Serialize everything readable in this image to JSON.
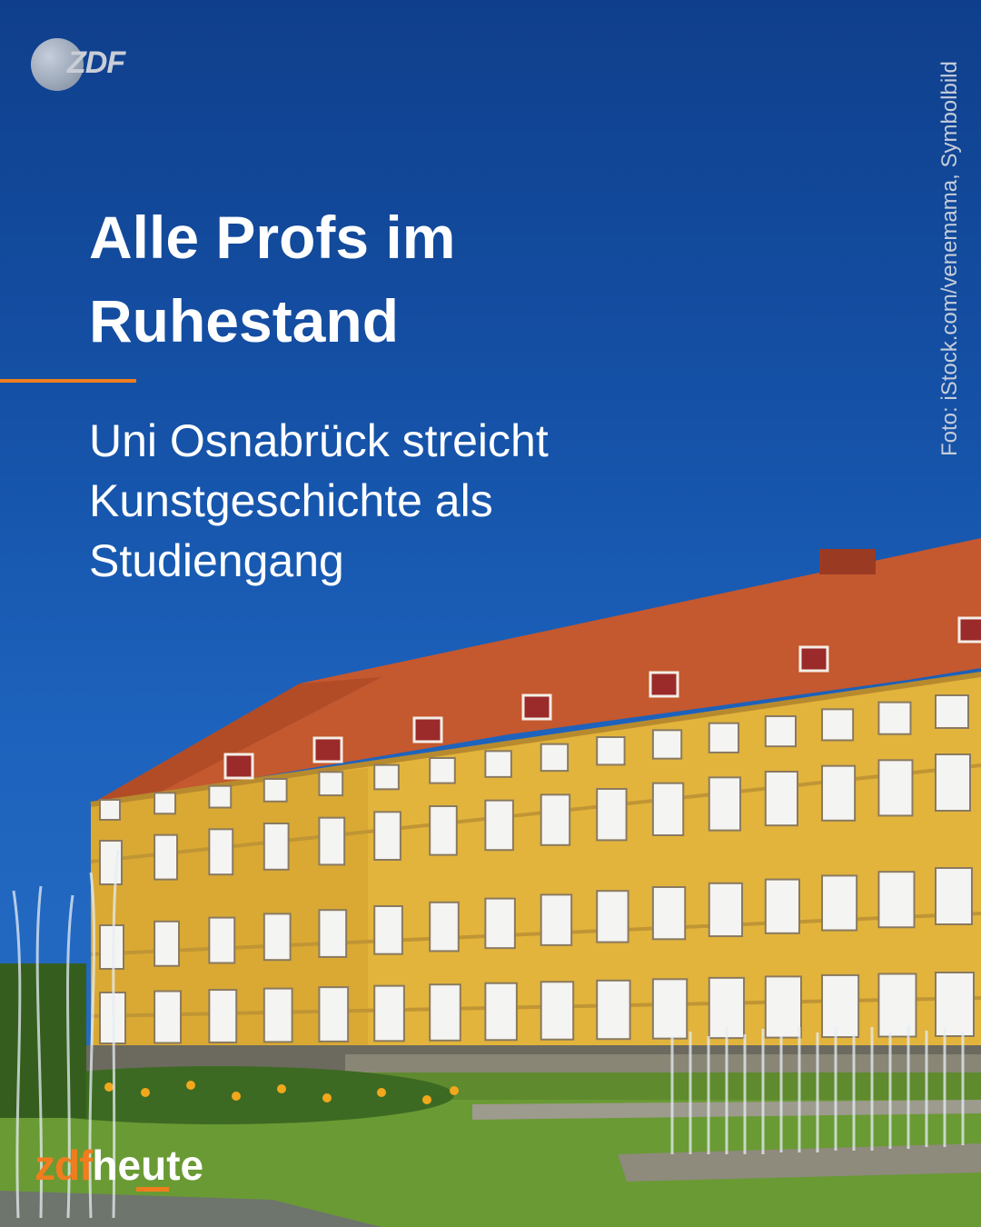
{
  "logo": {
    "text": "ZDF"
  },
  "credit": "Foto: iStock.com/venemama, Symbolbild",
  "headline": {
    "line1": "Alle Profs im",
    "line2": "Ruhestand"
  },
  "subline": {
    "line1": "Uni Osnabrück streicht",
    "line2": "Kunstgeschichte als",
    "line3": "Studiengang"
  },
  "brand": {
    "zdf": "zdf",
    "heute": "heute"
  },
  "colors": {
    "accent": "#f07d1e",
    "sky": "#1552a8",
    "facade": "#e2b43c",
    "roof": "#c4582f"
  }
}
